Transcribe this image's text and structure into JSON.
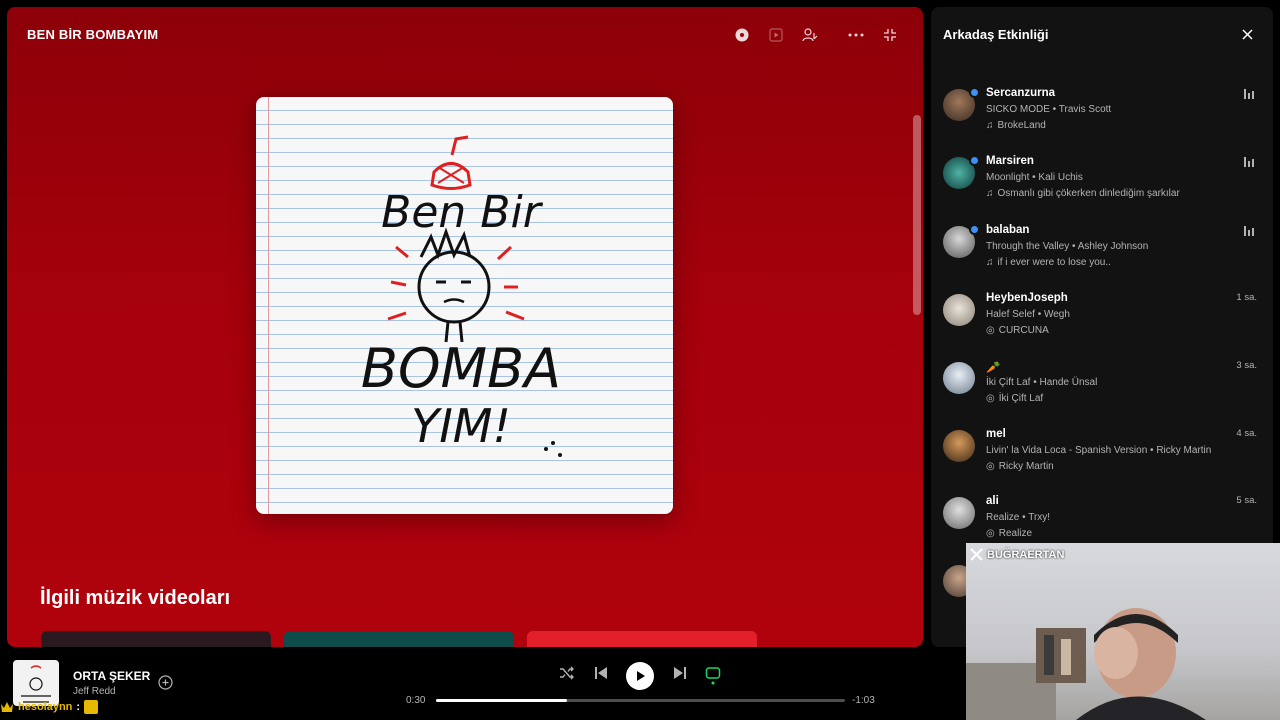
{
  "main": {
    "title": "BEN BİR BOMBAYIM",
    "section_title": "İlgili müzik videoları",
    "cover_text": [
      "Ben Bir",
      "BOMBA",
      "YIM!"
    ]
  },
  "friends": {
    "title": "Arkadaş Etkinliği",
    "items": [
      {
        "name": "Sercanzurna",
        "song": "SICKO MODE • Travis Scott",
        "context": "BrokeLand",
        "context_icon": "note-icon",
        "status": "playing",
        "time": ""
      },
      {
        "name": "Marsiren",
        "song": "Moonlight • Kali Uchis",
        "context": "Osmanlı gibi çökerken dinlediğim şarkılar",
        "context_icon": "note-icon",
        "status": "playing",
        "time": ""
      },
      {
        "name": "balaban",
        "song": "Through the Valley • Ashley Johnson",
        "context": "if i ever were to lose you..",
        "context_icon": "note-icon",
        "status": "playing",
        "time": ""
      },
      {
        "name": "HeybenJoseph",
        "song": "Halef Selef • Wegh",
        "context": "CURCUNA",
        "context_icon": "disc-icon",
        "status": "time",
        "time": "1 sa."
      },
      {
        "name": "🥕",
        "song": "İki Çift Laf • Hande Ünsal",
        "context": "İki Çift Laf",
        "context_icon": "disc-icon",
        "status": "time",
        "time": "3 sa."
      },
      {
        "name": "mel",
        "song": "Livin' la Vida Loca - Spanish Version • Ricky Martin",
        "context": "Ricky Martin",
        "context_icon": "disc-icon",
        "status": "time",
        "time": "4 sa."
      },
      {
        "name": "ali",
        "song": "Realize • Trxy!",
        "context": "Realize",
        "context_icon": "disc-icon",
        "status": "time",
        "time": "5 sa."
      }
    ]
  },
  "webcam": {
    "handle": "BUĞRAERTAN"
  },
  "player": {
    "track_title": "ORTA ŞEKER",
    "artist": "Jeff Redd",
    "elapsed": "0:30",
    "remaining": "-1:03",
    "progress": 0.32
  },
  "chat": {
    "username": "hesolaynn",
    "separator": ":"
  },
  "colors": {
    "accent_green": "#1ed760",
    "main_bg": "#a5010b",
    "panel_bg": "#121212",
    "online_dot": "#3d91f4"
  }
}
